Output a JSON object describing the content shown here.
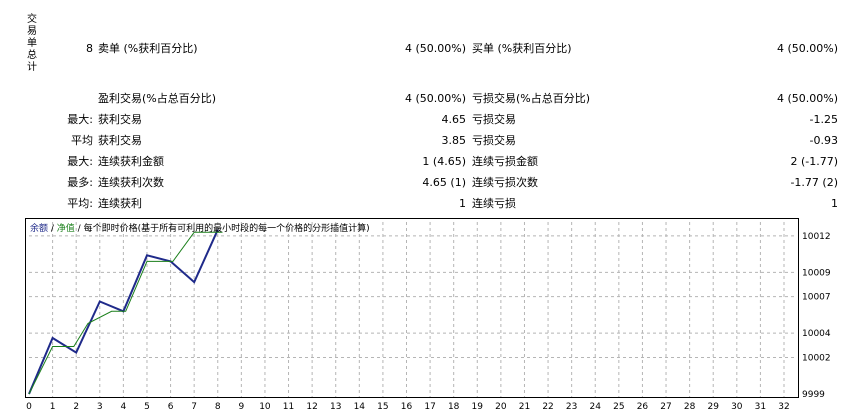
{
  "sidebar": {
    "title_chars": [
      "交",
      "易",
      "单",
      "总",
      "计"
    ]
  },
  "stats": {
    "row1": {
      "num": "8",
      "sell_label": "卖单 (%获利百分比)",
      "sell_value": "4 (50.00%)",
      "buy_label": "买单 (%获利百分比)",
      "buy_value": "4 (50.00%)"
    },
    "row2": {
      "profit_label": "盈利交易(%占总百分比)",
      "profit_value": "4 (50.00%)",
      "loss_label": "亏损交易(%占总百分比)",
      "loss_value": "4 (50.00%)"
    },
    "rows": [
      {
        "prefix": "最大:",
        "left_label": "获利交易",
        "left_value": "4.65",
        "right_label": "亏损交易",
        "right_value": "-1.25"
      },
      {
        "prefix": "平均",
        "left_label": "获利交易",
        "left_value": "3.85",
        "right_label": "亏损交易",
        "right_value": "-0.93"
      },
      {
        "prefix": "最大:",
        "left_label": "连续获利金额",
        "left_value": "1 (4.65)",
        "right_label": "连续亏损金额",
        "right_value": "2 (-1.77)"
      },
      {
        "prefix": "最多:",
        "left_label": "连续获利次数",
        "left_value": "4.65 (1)",
        "right_label": "连续亏损次数",
        "right_value": "-1.77 (2)"
      },
      {
        "prefix": "平均:",
        "left_label": "连续获利",
        "left_value": "1",
        "right_label": "连续亏损",
        "right_value": "1"
      }
    ]
  },
  "chart_legend": {
    "balance": "余额",
    "sep1": " / ",
    "equity": "净值",
    "sep2": " / ",
    "note": "每个即时价格(基于所有可利用的最小时段的每一个价格的分形插值计算)"
  },
  "chart_data": {
    "type": "line",
    "x_ticks": [
      0,
      1,
      2,
      3,
      4,
      5,
      6,
      7,
      8,
      9,
      10,
      11,
      12,
      13,
      14,
      15,
      16,
      17,
      18,
      19,
      20,
      21,
      22,
      23,
      24,
      25,
      26,
      27,
      28,
      29,
      30,
      31,
      32
    ],
    "y_ticks": [
      "10012",
      "10009",
      "10007",
      "10004",
      "10002",
      "9999"
    ],
    "ylim": [
      9999,
      10013.3
    ],
    "colors": {
      "balance": "#1f2a8a",
      "equity": "#1a7f1a",
      "grid": "#b5b5b5"
    },
    "series": [
      {
        "name": "余额",
        "x": [
          0,
          1,
          2,
          3,
          4,
          5,
          6,
          7,
          8
        ],
        "values": [
          9999.0,
          10003.6,
          10002.4,
          10006.6,
          10005.8,
          10010.4,
          10009.9,
          10008.2,
          10012.5
        ]
      },
      {
        "name": "净值",
        "x": [
          0,
          1,
          1.9,
          2.5,
          3.5,
          4.1,
          5.0,
          6.1,
          7.0,
          8.2
        ],
        "values": [
          9999.0,
          10002.9,
          10002.9,
          10004.8,
          10005.8,
          10005.8,
          10009.9,
          10009.9,
          10012.3,
          10012.3
        ]
      }
    ]
  }
}
